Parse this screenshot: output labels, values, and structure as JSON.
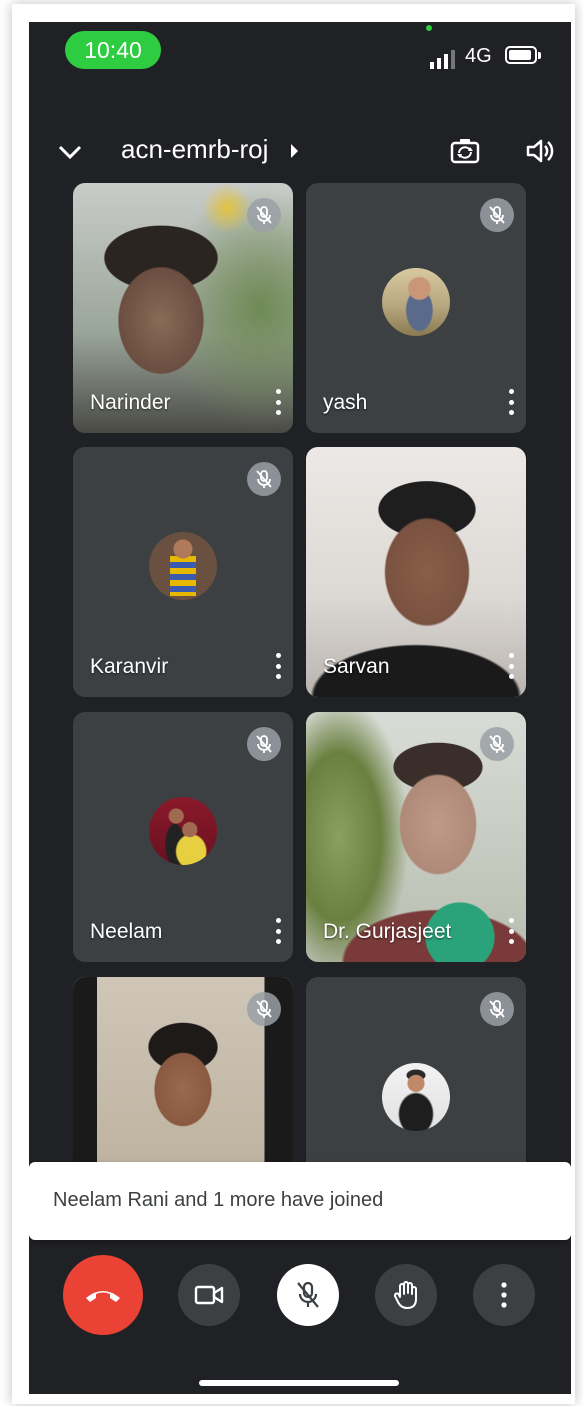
{
  "status_bar": {
    "time": "10:40",
    "network": "4G"
  },
  "header": {
    "meeting_code": "acn-emrb-roj"
  },
  "participants": [
    {
      "name": "Narinder",
      "muted": true,
      "video": true
    },
    {
      "name": "yash",
      "muted": true,
      "video": false
    },
    {
      "name": "Karanvir",
      "muted": true,
      "video": false
    },
    {
      "name": "Sarvan",
      "muted": true,
      "video": true
    },
    {
      "name": "Neelam",
      "muted": true,
      "video": false
    },
    {
      "name": "Dr. Gurjasjeet",
      "muted": true,
      "video": true
    },
    {
      "name": "",
      "muted": true,
      "video": true
    },
    {
      "name": "",
      "muted": true,
      "video": false
    }
  ],
  "toast": {
    "message": "Neelam Rani and 1 more have joined"
  },
  "controls": [
    "end-call",
    "camera",
    "microphone-muted",
    "raise-hand",
    "more-options"
  ],
  "colors": {
    "end_call": "#ea4335",
    "background": "#202124",
    "tile": "#3c4043"
  }
}
